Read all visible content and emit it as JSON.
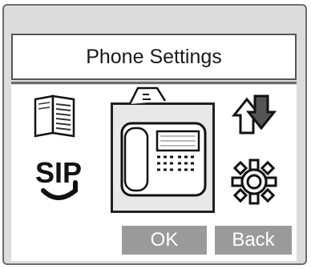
{
  "screen": {
    "title": "Phone Settings",
    "icons": [
      {
        "name": "directory-book-icon"
      },
      {
        "name": "phone-settings-icon"
      },
      {
        "name": "transfer-arrows-icon"
      },
      {
        "name": "sip-icon",
        "label": "SIP"
      },
      {
        "name": "gear-settings-icon"
      }
    ],
    "buttons": {
      "ok_label": "OK",
      "back_label": "Back"
    }
  }
}
